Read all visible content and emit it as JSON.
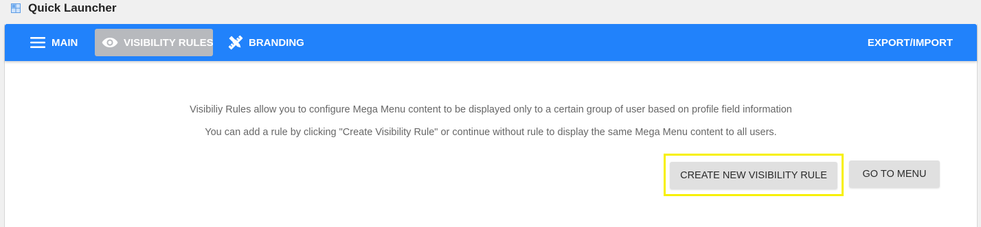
{
  "window": {
    "title": "Quick Launcher",
    "icon": "grid-icon"
  },
  "navbar": {
    "color": "#2182fb",
    "items": [
      {
        "label": "MAIN",
        "icon": "hamburger-menu-icon",
        "active": false
      },
      {
        "label": "VISIBILITY RULES",
        "icon": "eye-icon",
        "active": true
      },
      {
        "label": "BRANDING",
        "icon": "pencil-ruler-icon",
        "active": false
      }
    ],
    "export_label": "EXPORT/IMPORT"
  },
  "content": {
    "description_line1": "Visibiliy Rules allow you to configure Mega Menu content to be displayed only to a certain group of user based on profile field information",
    "description_line2": "You can add a rule by clicking \"Create Visibility Rule\" or continue without rule to display the same Mega Menu content to all users."
  },
  "actions": {
    "create_label": "CREATE NEW VISIBILITY RULE",
    "goto_label": "GO TO MENU",
    "highlight_color": "#f7f000"
  }
}
